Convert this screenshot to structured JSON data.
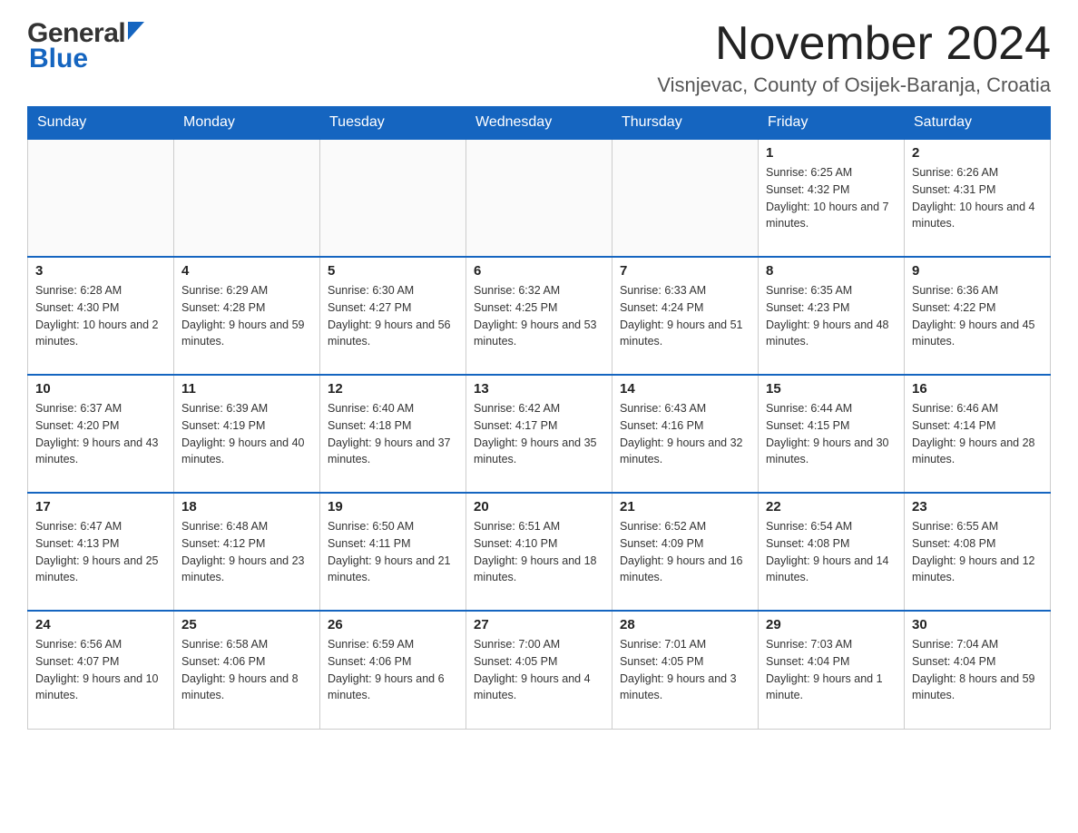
{
  "header": {
    "logo_general": "General",
    "logo_blue": "Blue",
    "month_title": "November 2024",
    "location": "Visnjevac, County of Osijek-Baranja, Croatia"
  },
  "calendar": {
    "days_of_week": [
      "Sunday",
      "Monday",
      "Tuesday",
      "Wednesday",
      "Thursday",
      "Friday",
      "Saturday"
    ],
    "weeks": [
      [
        {
          "day": "",
          "sunrise": "",
          "sunset": "",
          "daylight": ""
        },
        {
          "day": "",
          "sunrise": "",
          "sunset": "",
          "daylight": ""
        },
        {
          "day": "",
          "sunrise": "",
          "sunset": "",
          "daylight": ""
        },
        {
          "day": "",
          "sunrise": "",
          "sunset": "",
          "daylight": ""
        },
        {
          "day": "",
          "sunrise": "",
          "sunset": "",
          "daylight": ""
        },
        {
          "day": "1",
          "sunrise": "Sunrise: 6:25 AM",
          "sunset": "Sunset: 4:32 PM",
          "daylight": "Daylight: 10 hours and 7 minutes."
        },
        {
          "day": "2",
          "sunrise": "Sunrise: 6:26 AM",
          "sunset": "Sunset: 4:31 PM",
          "daylight": "Daylight: 10 hours and 4 minutes."
        }
      ],
      [
        {
          "day": "3",
          "sunrise": "Sunrise: 6:28 AM",
          "sunset": "Sunset: 4:30 PM",
          "daylight": "Daylight: 10 hours and 2 minutes."
        },
        {
          "day": "4",
          "sunrise": "Sunrise: 6:29 AM",
          "sunset": "Sunset: 4:28 PM",
          "daylight": "Daylight: 9 hours and 59 minutes."
        },
        {
          "day": "5",
          "sunrise": "Sunrise: 6:30 AM",
          "sunset": "Sunset: 4:27 PM",
          "daylight": "Daylight: 9 hours and 56 minutes."
        },
        {
          "day": "6",
          "sunrise": "Sunrise: 6:32 AM",
          "sunset": "Sunset: 4:25 PM",
          "daylight": "Daylight: 9 hours and 53 minutes."
        },
        {
          "day": "7",
          "sunrise": "Sunrise: 6:33 AM",
          "sunset": "Sunset: 4:24 PM",
          "daylight": "Daylight: 9 hours and 51 minutes."
        },
        {
          "day": "8",
          "sunrise": "Sunrise: 6:35 AM",
          "sunset": "Sunset: 4:23 PM",
          "daylight": "Daylight: 9 hours and 48 minutes."
        },
        {
          "day": "9",
          "sunrise": "Sunrise: 6:36 AM",
          "sunset": "Sunset: 4:22 PM",
          "daylight": "Daylight: 9 hours and 45 minutes."
        }
      ],
      [
        {
          "day": "10",
          "sunrise": "Sunrise: 6:37 AM",
          "sunset": "Sunset: 4:20 PM",
          "daylight": "Daylight: 9 hours and 43 minutes."
        },
        {
          "day": "11",
          "sunrise": "Sunrise: 6:39 AM",
          "sunset": "Sunset: 4:19 PM",
          "daylight": "Daylight: 9 hours and 40 minutes."
        },
        {
          "day": "12",
          "sunrise": "Sunrise: 6:40 AM",
          "sunset": "Sunset: 4:18 PM",
          "daylight": "Daylight: 9 hours and 37 minutes."
        },
        {
          "day": "13",
          "sunrise": "Sunrise: 6:42 AM",
          "sunset": "Sunset: 4:17 PM",
          "daylight": "Daylight: 9 hours and 35 minutes."
        },
        {
          "day": "14",
          "sunrise": "Sunrise: 6:43 AM",
          "sunset": "Sunset: 4:16 PM",
          "daylight": "Daylight: 9 hours and 32 minutes."
        },
        {
          "day": "15",
          "sunrise": "Sunrise: 6:44 AM",
          "sunset": "Sunset: 4:15 PM",
          "daylight": "Daylight: 9 hours and 30 minutes."
        },
        {
          "day": "16",
          "sunrise": "Sunrise: 6:46 AM",
          "sunset": "Sunset: 4:14 PM",
          "daylight": "Daylight: 9 hours and 28 minutes."
        }
      ],
      [
        {
          "day": "17",
          "sunrise": "Sunrise: 6:47 AM",
          "sunset": "Sunset: 4:13 PM",
          "daylight": "Daylight: 9 hours and 25 minutes."
        },
        {
          "day": "18",
          "sunrise": "Sunrise: 6:48 AM",
          "sunset": "Sunset: 4:12 PM",
          "daylight": "Daylight: 9 hours and 23 minutes."
        },
        {
          "day": "19",
          "sunrise": "Sunrise: 6:50 AM",
          "sunset": "Sunset: 4:11 PM",
          "daylight": "Daylight: 9 hours and 21 minutes."
        },
        {
          "day": "20",
          "sunrise": "Sunrise: 6:51 AM",
          "sunset": "Sunset: 4:10 PM",
          "daylight": "Daylight: 9 hours and 18 minutes."
        },
        {
          "day": "21",
          "sunrise": "Sunrise: 6:52 AM",
          "sunset": "Sunset: 4:09 PM",
          "daylight": "Daylight: 9 hours and 16 minutes."
        },
        {
          "day": "22",
          "sunrise": "Sunrise: 6:54 AM",
          "sunset": "Sunset: 4:08 PM",
          "daylight": "Daylight: 9 hours and 14 minutes."
        },
        {
          "day": "23",
          "sunrise": "Sunrise: 6:55 AM",
          "sunset": "Sunset: 4:08 PM",
          "daylight": "Daylight: 9 hours and 12 minutes."
        }
      ],
      [
        {
          "day": "24",
          "sunrise": "Sunrise: 6:56 AM",
          "sunset": "Sunset: 4:07 PM",
          "daylight": "Daylight: 9 hours and 10 minutes."
        },
        {
          "day": "25",
          "sunrise": "Sunrise: 6:58 AM",
          "sunset": "Sunset: 4:06 PM",
          "daylight": "Daylight: 9 hours and 8 minutes."
        },
        {
          "day": "26",
          "sunrise": "Sunrise: 6:59 AM",
          "sunset": "Sunset: 4:06 PM",
          "daylight": "Daylight: 9 hours and 6 minutes."
        },
        {
          "day": "27",
          "sunrise": "Sunrise: 7:00 AM",
          "sunset": "Sunset: 4:05 PM",
          "daylight": "Daylight: 9 hours and 4 minutes."
        },
        {
          "day": "28",
          "sunrise": "Sunrise: 7:01 AM",
          "sunset": "Sunset: 4:05 PM",
          "daylight": "Daylight: 9 hours and 3 minutes."
        },
        {
          "day": "29",
          "sunrise": "Sunrise: 7:03 AM",
          "sunset": "Sunset: 4:04 PM",
          "daylight": "Daylight: 9 hours and 1 minute."
        },
        {
          "day": "30",
          "sunrise": "Sunrise: 7:04 AM",
          "sunset": "Sunset: 4:04 PM",
          "daylight": "Daylight: 8 hours and 59 minutes."
        }
      ]
    ]
  }
}
